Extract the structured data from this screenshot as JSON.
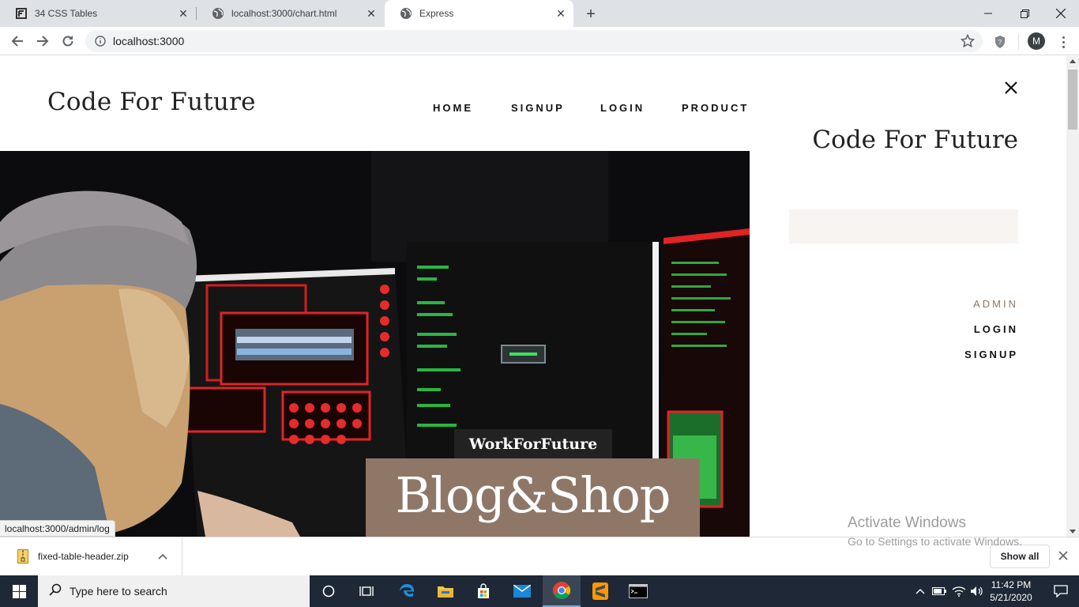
{
  "browser": {
    "tabs": [
      {
        "label": "34 CSS Tables",
        "icon": "f-logo-icon"
      },
      {
        "label": "localhost:3000/chart.html",
        "icon": "globe-icon"
      },
      {
        "label": "Express",
        "icon": "globe-icon",
        "active": true
      }
    ],
    "url": "localhost:3000",
    "profile_initial": "M"
  },
  "page": {
    "logo": "Code For Future",
    "nav": [
      "HOME",
      "SIGNUP",
      "LOGIN",
      "PRODUCT"
    ],
    "sidebar": {
      "logo": "Code For Future",
      "search_value": "",
      "links": [
        "ADMIN",
        "LOGIN",
        "SIGNUP"
      ]
    },
    "hero": {
      "tag": "WorkForFuture",
      "title": "Blog&Shop"
    },
    "status_url": "localhost:3000/admin/log"
  },
  "watermark": {
    "line1": "Activate Windows",
    "line2": "Go to Settings to activate Windows."
  },
  "downloads": {
    "file": "fixed-table-header.zip",
    "show_all": "Show all"
  },
  "taskbar": {
    "search_placeholder": "Type here to search",
    "time": "11:42 PM",
    "date": "5/21/2020"
  },
  "colors": {
    "accent_brown": "#8f7768",
    "admin_link": "#8e7666",
    "search_bg": "#f8f4f2"
  }
}
